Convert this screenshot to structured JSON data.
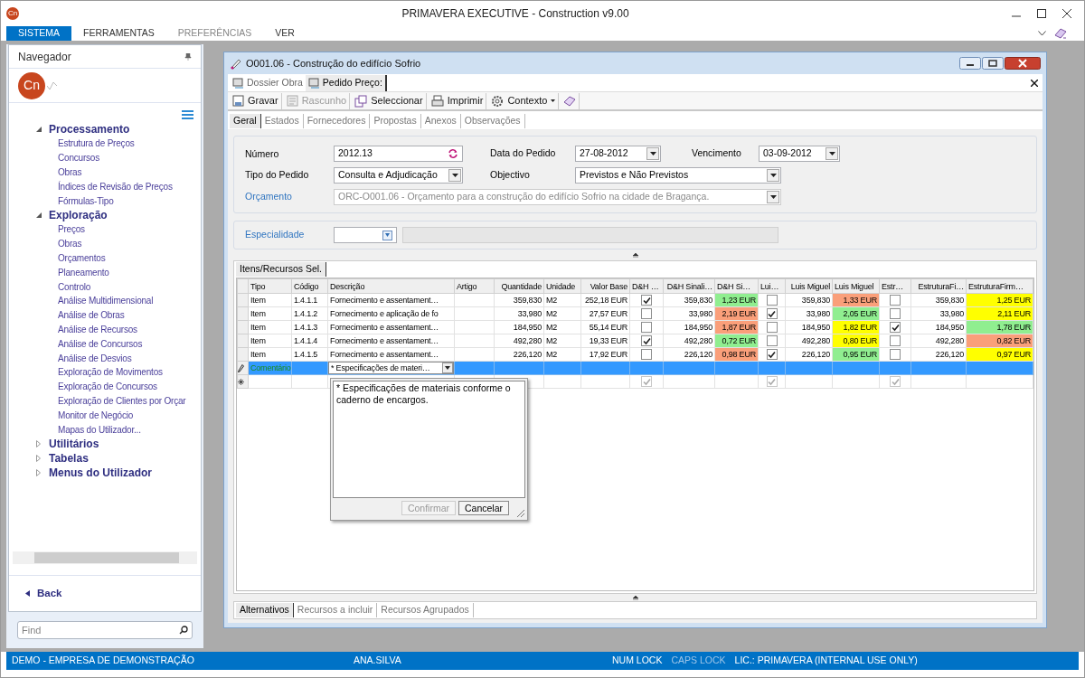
{
  "app": {
    "logo": "Cn",
    "title": "PRIMAVERA EXECUTIVE - Construction v9.00"
  },
  "menu": [
    {
      "label": "SISTEMA",
      "selected": true,
      "disabled": false
    },
    {
      "label": "FERRAMENTAS",
      "selected": false,
      "disabled": false
    },
    {
      "label": "PREFERÊNCIAS",
      "selected": false,
      "disabled": true
    },
    {
      "label": "VER",
      "selected": false,
      "disabled": false
    }
  ],
  "navigator": {
    "title": "Navegador",
    "logo": "Cn",
    "groups": [
      {
        "label": "Processamento",
        "expanded": true,
        "children": [
          {
            "label": "Estrutura de Preços"
          },
          {
            "label": "Concursos"
          },
          {
            "label": "Obras"
          },
          {
            "label": "Índices de Revisão de Preços"
          },
          {
            "label": "Fórmulas-Tipo"
          }
        ]
      },
      {
        "label": "Exploração",
        "expanded": true,
        "children": [
          {
            "label": "Preços"
          },
          {
            "label": "Obras"
          },
          {
            "label": "Orçamentos"
          },
          {
            "label": "Planeamento"
          },
          {
            "label": "Controlo"
          },
          {
            "label": "Análise Multidimensional"
          },
          {
            "label": "Análise de Obras"
          },
          {
            "label": "Análise de Recursos"
          },
          {
            "label": "Análise de Concursos"
          },
          {
            "label": "Análise de Desvios"
          },
          {
            "label": "Exploração de Movimentos"
          },
          {
            "label": "Exploração de Concursos"
          },
          {
            "label": "Exploração de Clientes por Orçar"
          },
          {
            "label": "Monitor de Negócio"
          },
          {
            "label": "Mapas do Utilizador..."
          }
        ]
      },
      {
        "label": "Utilitários",
        "expanded": false
      },
      {
        "label": "Tabelas",
        "expanded": false
      },
      {
        "label": "Menus do Utilizador",
        "expanded": false
      }
    ],
    "back": "Back",
    "find_placeholder": "Find"
  },
  "document": {
    "title": "O001.06 - Construção do edifício Sofrio",
    "doc_tabs": [
      {
        "label": "Dossier Obra",
        "selected": false
      },
      {
        "label": "Pedido Preço:",
        "selected": true
      }
    ],
    "toolbar": [
      {
        "kind": "save",
        "label": "Gravar",
        "disabled": false
      },
      {
        "kind": "draft",
        "label": "Rascunho",
        "disabled": true
      },
      {
        "kind": "select",
        "label": "Seleccionar",
        "disabled": false
      },
      {
        "kind": "print",
        "label": "Imprimir",
        "disabled": false
      },
      {
        "kind": "context",
        "label": "Contexto",
        "disabled": false
      },
      {
        "kind": "book",
        "disabled": false
      }
    ],
    "tabs": [
      {
        "label": "Geral",
        "selected": true
      },
      {
        "label": "Estados",
        "selected": false
      },
      {
        "label": "Fornecedores",
        "selected": false
      },
      {
        "label": "Propostas",
        "selected": false
      },
      {
        "label": "Anexos",
        "selected": false
      },
      {
        "label": "Observações",
        "selected": false
      }
    ],
    "form": {
      "numero": {
        "label": "Número",
        "value": "2012.13"
      },
      "data_pedido": {
        "label": "Data do Pedido",
        "value": "27-08-2012"
      },
      "vencimento": {
        "label": "Vencimento",
        "value": "03-09-2012"
      },
      "tipo_pedido": {
        "label": "Tipo do Pedido",
        "value": "Consulta e Adjudicação"
      },
      "objectivo": {
        "label": "Objectivo",
        "value": "Previstos e Não Previstos"
      },
      "orcamento": {
        "label": "Orçamento",
        "value": "ORC-O001.06 - Orçamento para a construção do edifício Sofrio na cidade de Bragança.",
        "disabled": true
      },
      "especialidade": {
        "label": "Especialidade"
      }
    },
    "grid_tabs": [
      {
        "label": "Itens/Recursos Sel.",
        "selected": true
      }
    ],
    "grid": {
      "columns": [
        {
          "label": "Tipo",
          "kind": "text"
        },
        {
          "label": "Código",
          "kind": "text"
        },
        {
          "label": "Descrição",
          "kind": "text"
        },
        {
          "label": "Artigo",
          "kind": "text"
        },
        {
          "label": "Quantidade",
          "kind": "number"
        },
        {
          "label": "Unidade",
          "kind": "text"
        },
        {
          "label": "Valor Base",
          "kind": "number"
        },
        {
          "label": "D&H …",
          "kind": "check"
        },
        {
          "label": "D&H Sinali…",
          "kind": "number"
        },
        {
          "label": "D&H Si…",
          "kind": "price"
        },
        {
          "label": "Lui…",
          "kind": "check"
        },
        {
          "label": "Luis Miguel",
          "kind": "number"
        },
        {
          "label": "Luis Miguel",
          "kind": "price"
        },
        {
          "label": "Estr…",
          "kind": "check"
        },
        {
          "label": "EstruturaFi…",
          "kind": "number"
        },
        {
          "label": "EstruturaFirm…",
          "kind": "price"
        }
      ],
      "rows": [
        {
          "cells": [
            {
              "text": "Item"
            },
            {
              "text": "1.4.1.1"
            },
            {
              "text": "Fornecimento e assentament…"
            },
            {
              "text": ""
            },
            {
              "text": "359,830"
            },
            {
              "text": "M2"
            },
            {
              "text": "252,18 EUR"
            },
            {
              "checked": true
            },
            {
              "text": "359,830"
            },
            {
              "text": "1,23 EUR",
              "color": "#90ee90"
            },
            {
              "checked": false
            },
            {
              "text": "359,830"
            },
            {
              "text": "1,33 EUR",
              "color": "#fa9f7a"
            },
            {
              "checked": false
            },
            {
              "text": "359,830"
            },
            {
              "text": "1,25 EUR",
              "color": "#ffff00"
            }
          ]
        },
        {
          "cells": [
            {
              "text": "Item"
            },
            {
              "text": "1.4.1.2"
            },
            {
              "text": "Fornecimento e aplicação de fo"
            },
            {
              "text": ""
            },
            {
              "text": "33,980"
            },
            {
              "text": "M2"
            },
            {
              "text": "27,57 EUR"
            },
            {
              "checked": false
            },
            {
              "text": "33,980"
            },
            {
              "text": "2,19 EUR",
              "color": "#fa9f7a"
            },
            {
              "checked": true
            },
            {
              "text": "33,980"
            },
            {
              "text": "2,05 EUR",
              "color": "#90ee90"
            },
            {
              "checked": false
            },
            {
              "text": "33,980"
            },
            {
              "text": "2,11 EUR",
              "color": "#ffff00"
            }
          ]
        },
        {
          "cells": [
            {
              "text": "Item"
            },
            {
              "text": "1.4.1.3"
            },
            {
              "text": "Fornecimento e assentament…"
            },
            {
              "text": ""
            },
            {
              "text": "184,950"
            },
            {
              "text": "M2"
            },
            {
              "text": "55,14 EUR"
            },
            {
              "checked": false
            },
            {
              "text": "184,950"
            },
            {
              "text": "1,87 EUR",
              "color": "#fa9f7a"
            },
            {
              "checked": false
            },
            {
              "text": "184,950"
            },
            {
              "text": "1,82 EUR",
              "color": "#ffff00"
            },
            {
              "checked": true
            },
            {
              "text": "184,950"
            },
            {
              "text": "1,78 EUR",
              "color": "#90ee90"
            }
          ]
        },
        {
          "cells": [
            {
              "text": "Item"
            },
            {
              "text": "1.4.1.4"
            },
            {
              "text": "Fornecimento e assentament…"
            },
            {
              "text": ""
            },
            {
              "text": "492,280"
            },
            {
              "text": "M2"
            },
            {
              "text": "19,33 EUR"
            },
            {
              "checked": true
            },
            {
              "text": "492,280"
            },
            {
              "text": "0,72 EUR",
              "color": "#90ee90"
            },
            {
              "checked": false
            },
            {
              "text": "492,280"
            },
            {
              "text": "0,80 EUR",
              "color": "#ffff00"
            },
            {
              "checked": false
            },
            {
              "text": "492,280"
            },
            {
              "text": "0,82 EUR",
              "color": "#fa9f7a"
            }
          ]
        },
        {
          "cells": [
            {
              "text": "Item"
            },
            {
              "text": "1.4.1.5"
            },
            {
              "text": "Fornecimento e assentament…"
            },
            {
              "text": ""
            },
            {
              "text": "226,120"
            },
            {
              "text": "M2"
            },
            {
              "text": "17,92 EUR"
            },
            {
              "checked": false
            },
            {
              "text": "226,120"
            },
            {
              "text": "0,98 EUR",
              "color": "#fa9f7a"
            },
            {
              "checked": true
            },
            {
              "text": "226,120"
            },
            {
              "text": "0,95 EUR",
              "color": "#90ee90"
            },
            {
              "checked": false
            },
            {
              "text": "226,120"
            },
            {
              "text": "0,97 EUR",
              "color": "#ffff00"
            }
          ]
        }
      ],
      "edit_row": {
        "label": "Comentário",
        "value": "* Especificações de materi…",
        "selected": true
      },
      "new_row": {
        "checks": [
          {
            "checked": true
          },
          {
            "checked": true
          },
          {
            "checked": true
          }
        ]
      },
      "memo": {
        "text": "* Especificações de materiais conforme o caderno de encargos.",
        "confirm": {
          "label": "Confirmar",
          "disabled": true
        },
        "cancel": {
          "label": "Cancelar",
          "disabled": false
        }
      }
    },
    "bottom_tabs": [
      {
        "label": "Alternativos",
        "selected": true
      },
      {
        "label": "Recursos a incluir",
        "selected": false
      },
      {
        "label": "Recursos Agrupados",
        "selected": false
      }
    ]
  },
  "status_bar": [
    {
      "label": "DEMO - EMPRESA DE DEMONSTRAÇÃO",
      "disabled": false
    },
    {
      "label": "ANA.SILVA",
      "disabled": false
    },
    {
      "label": "NUM LOCK",
      "disabled": false
    },
    {
      "label": "CAPS LOCK",
      "disabled": true
    },
    {
      "label": "LIC.: PRIMAVERA (INTERNAL USE ONLY)",
      "disabled": false
    }
  ]
}
